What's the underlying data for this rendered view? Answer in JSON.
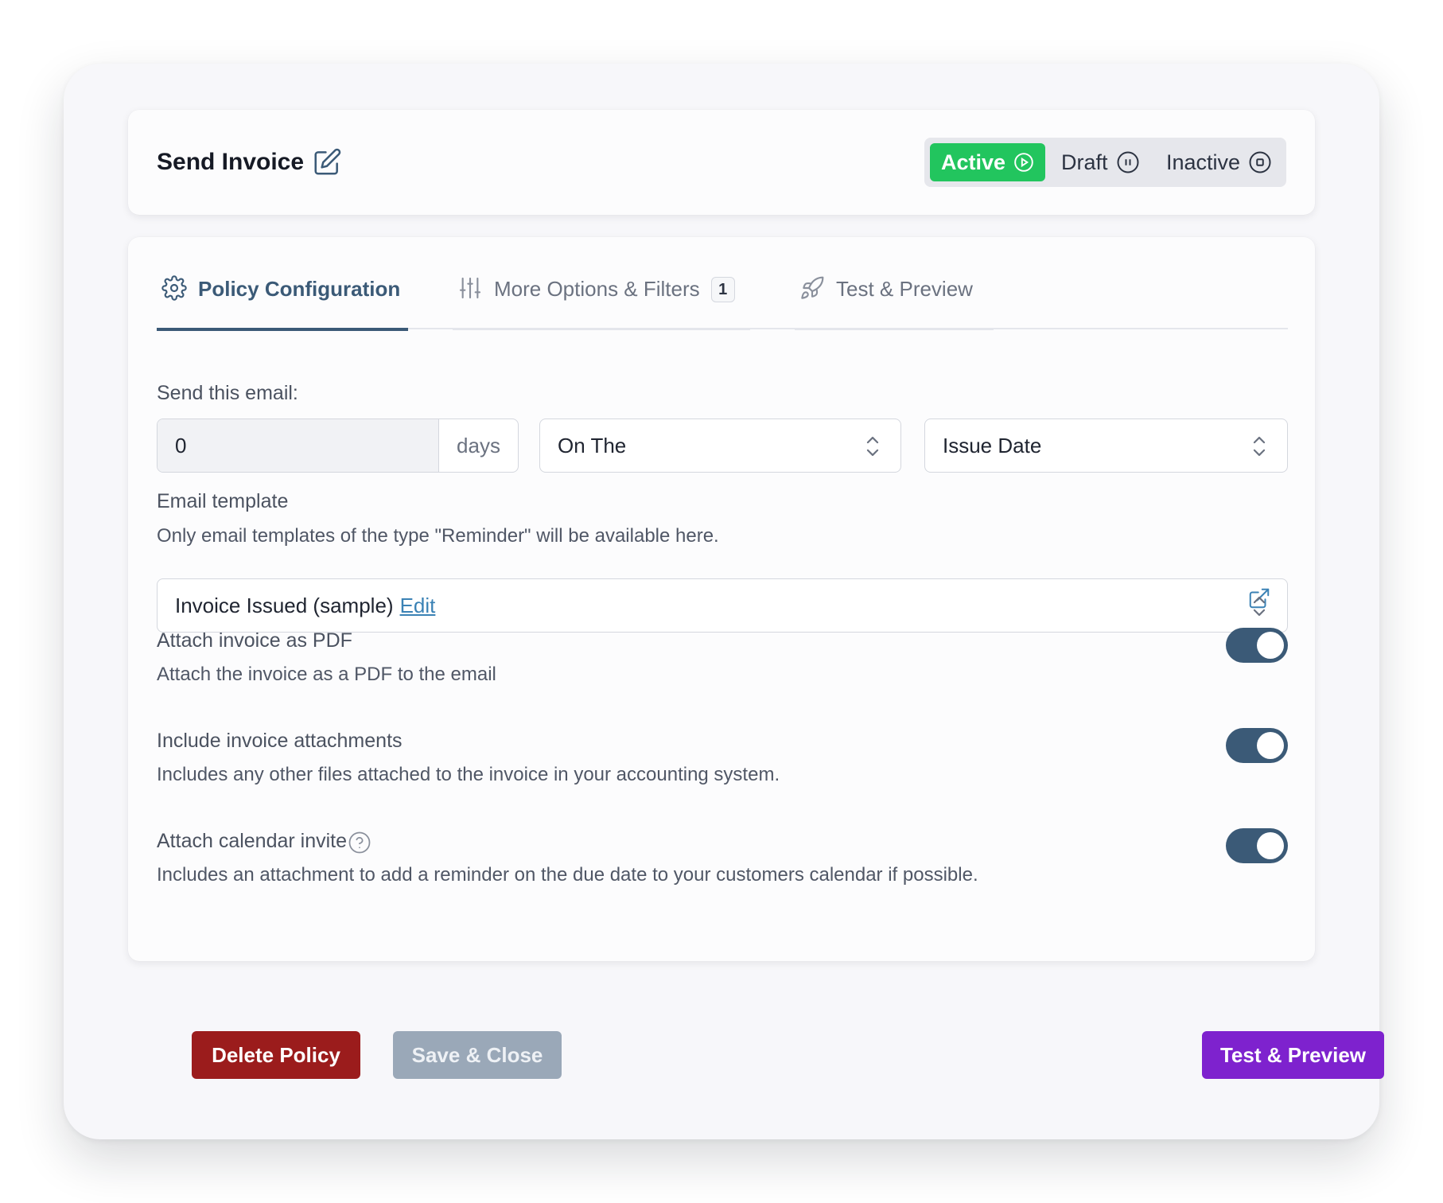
{
  "header": {
    "title": "Send Invoice",
    "status": {
      "active_label": "Active",
      "draft_label": "Draft",
      "inactive_label": "Inactive",
      "selected": "Active"
    }
  },
  "tabs": [
    {
      "label": "Policy Configuration",
      "icon": "gear-icon",
      "selected": true
    },
    {
      "label": "More Options & Filters",
      "icon": "sliders-icon",
      "badge": "1"
    },
    {
      "label": "Test & Preview",
      "icon": "rocket-icon"
    }
  ],
  "schedule": {
    "label": "Send this email:",
    "offset_value": "0",
    "offset_unit": "days",
    "relation": "On The",
    "reference": "Issue Date"
  },
  "template": {
    "label": "Email template",
    "help": "Only email templates of the type \"Reminder\" will be available here.",
    "selected": "Invoice Issued (sample)",
    "edit_label": "Edit"
  },
  "options": [
    {
      "title": "Attach invoice as PDF",
      "description": "Attach the invoice as a PDF to the email",
      "enabled": true
    },
    {
      "title": "Include invoice attachments",
      "description": "Includes any other files attached to the invoice in your accounting system.",
      "enabled": true
    },
    {
      "title": "Attach calendar invite",
      "description": "Includes an attachment to add a reminder on the due date to your customers calendar if possible.",
      "enabled": true,
      "help_icon": "question-circle-icon"
    }
  ],
  "footer": {
    "delete_label": "Delete Policy",
    "save_label": "Save & Close",
    "test_label": "Test & Preview"
  },
  "colors": {
    "active": "#22c55e",
    "primary": "#3b5a77",
    "danger": "#9b1c1c",
    "disabled": "#9aa8b8",
    "purple": "#7e22ce",
    "link": "#3b82b5"
  }
}
